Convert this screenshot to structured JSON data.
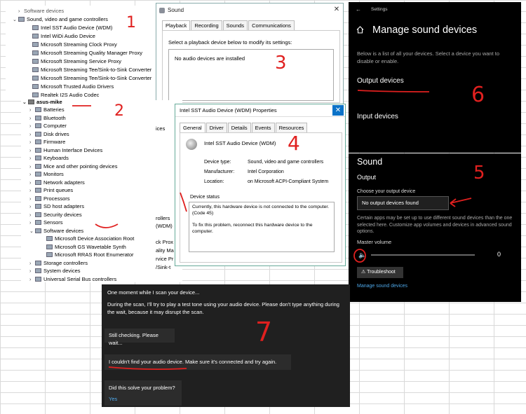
{
  "device_manager_top": {
    "rows": [
      "Software devices",
      "Sound, video and game controllers",
      "Intel SST Audio Device (WDM)",
      "Intel WiDi Audio Device",
      "Microsoft Streaming Clock Proxy",
      "Microsoft Streaming Quality Manager Proxy",
      "Microsoft Streaming Service Proxy",
      "Microsoft Streaming Tee/Sink-to-Sink Converter",
      "Microsoft Streaming Tee/Sink-to-Sink Converter",
      "Microsoft Trusted Audio Drivers",
      "Realtek I2S Audio Codec"
    ]
  },
  "sound_dialog": {
    "title": "Sound",
    "tabs": [
      "Playback",
      "Recording",
      "Sounds",
      "Communications"
    ],
    "instruction": "Select a playback device below to modify its settings:",
    "empty_message": "No audio devices are installed"
  },
  "settings": {
    "header": "Settings",
    "title": "Manage sound devices",
    "description": "Below is a list of all your devices. Select a device you want to disable or enable.",
    "output_devices": "Output devices",
    "input_devices": "Input devices"
  },
  "sound_panel": {
    "title": "Sound",
    "output_heading": "Output",
    "choose_label": "Choose your output device",
    "selected_device": "No output devices found",
    "note": "Certain apps may be set up to use different sound devices than the one selected here. Customize app volumes and devices in advanced sound options.",
    "master_volume_label": "Master volume",
    "volume_value": "0",
    "volume_level": 0,
    "troubleshoot_label": "Troubleshoot",
    "manage_link": "Manage sound devices"
  },
  "device_manager_tree": {
    "root": "asus-mike",
    "items": [
      "Batteries",
      "Bluetooth",
      "Computer",
      "Disk drives",
      "Firmware",
      "Human Interface Devices",
      "Keyboards",
      "Mice and other pointing devices",
      "Monitors",
      "Network adapters",
      "Print queues",
      "Processors",
      "SD host adapters",
      "Security devices",
      "Sensors",
      "Software devices",
      "Microsoft Device Association Root",
      "Microsoft GS Wavetable Synth",
      "Microsoft RRAS Root Enumerator",
      "Storage controllers",
      "System devices",
      "Universal Serial Bus controllers"
    ],
    "partial_texts": [
      "ices",
      "rollers",
      "(WDM)",
      "ck Prox",
      "ality Ma",
      "rvice Pr",
      "/Sink-t"
    ]
  },
  "properties_dialog": {
    "title": "Intel SST Audio Device (WDM) Properties",
    "tabs": [
      "General",
      "Driver",
      "Details",
      "Events",
      "Resources"
    ],
    "device_name": "Intel SST Audio Device (WDM)",
    "fields": [
      {
        "label": "Device type:",
        "value": "Sound, video and game controllers"
      },
      {
        "label": "Manufacturer:",
        "value": "Intel Corporation"
      },
      {
        "label": "Location:",
        "value": "on Microsoft ACPI-Compliant System"
      }
    ],
    "status_label": "Device status",
    "status_text_1": "Currently, this hardware device is not connected to the computer. (Code 45)",
    "status_text_2": "To fix this problem, reconnect this hardware device to the computer."
  },
  "troubleshooter": {
    "line1": "One moment while I scan your device...",
    "line2": "During the scan, I'll try to play a test tone using your audio device.  Please don't type anything during the wait, because it may disrupt the scan.",
    "line3": "Still checking. Please wait...",
    "line4": "I couldn't find your audio device. Make sure it's connected and try again.",
    "line5": "Did this solve your problem?",
    "yes": "Yes"
  },
  "annotations": [
    "1",
    "2",
    "3",
    "4",
    "5",
    "6",
    "7"
  ],
  "colors": {
    "annotation": "#e0201f",
    "accent": "#0a72c8",
    "dark_bg": "#000000"
  }
}
